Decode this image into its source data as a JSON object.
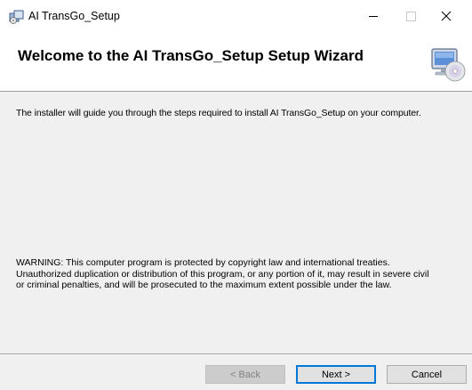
{
  "window": {
    "title": "AI TransGo_Setup",
    "controls": {
      "minimize": "minimize",
      "maximize": "maximize",
      "close": "close"
    }
  },
  "banner": {
    "title": "Welcome to the AI TransGo_Setup Setup Wizard",
    "icon": "computer-disc-icon"
  },
  "body": {
    "intro": "The installer will guide you through the steps required to install AI TransGo_Setup on your computer.",
    "warning_lines": [
      "WARNING: This computer program is protected by copyright law and international treaties.",
      "Unauthorized duplication or distribution of this program, or any portion of it, may result in severe civil",
      "or criminal penalties, and will be prosecuted to the maximum extent possible under the law."
    ]
  },
  "buttons": {
    "back": "< Back",
    "next": "Next >",
    "cancel": "Cancel"
  },
  "colors": {
    "accent": "#0078d7",
    "window_bg": "#f0f0f0",
    "banner_bg": "#ffffff"
  }
}
